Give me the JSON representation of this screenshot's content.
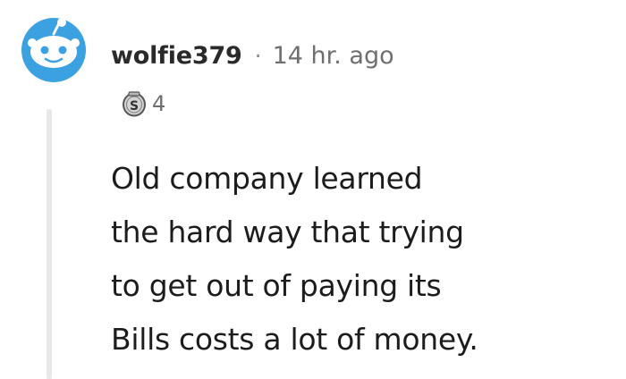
{
  "comment": {
    "username": "wolfie379",
    "separator": "·",
    "timestamp": "14 hr. ago",
    "award": {
      "icon": "silver-award-icon",
      "letter": "S",
      "count": "4"
    },
    "body_lines": [
      "Old company learned",
      "the hard way that trying",
      "to get out of paying its",
      "Bills costs a lot of money."
    ]
  },
  "colors": {
    "avatar_bg": "#3ba1e0",
    "thread_line": "#e8e8e8",
    "meta_text": "#6f6f6f"
  }
}
